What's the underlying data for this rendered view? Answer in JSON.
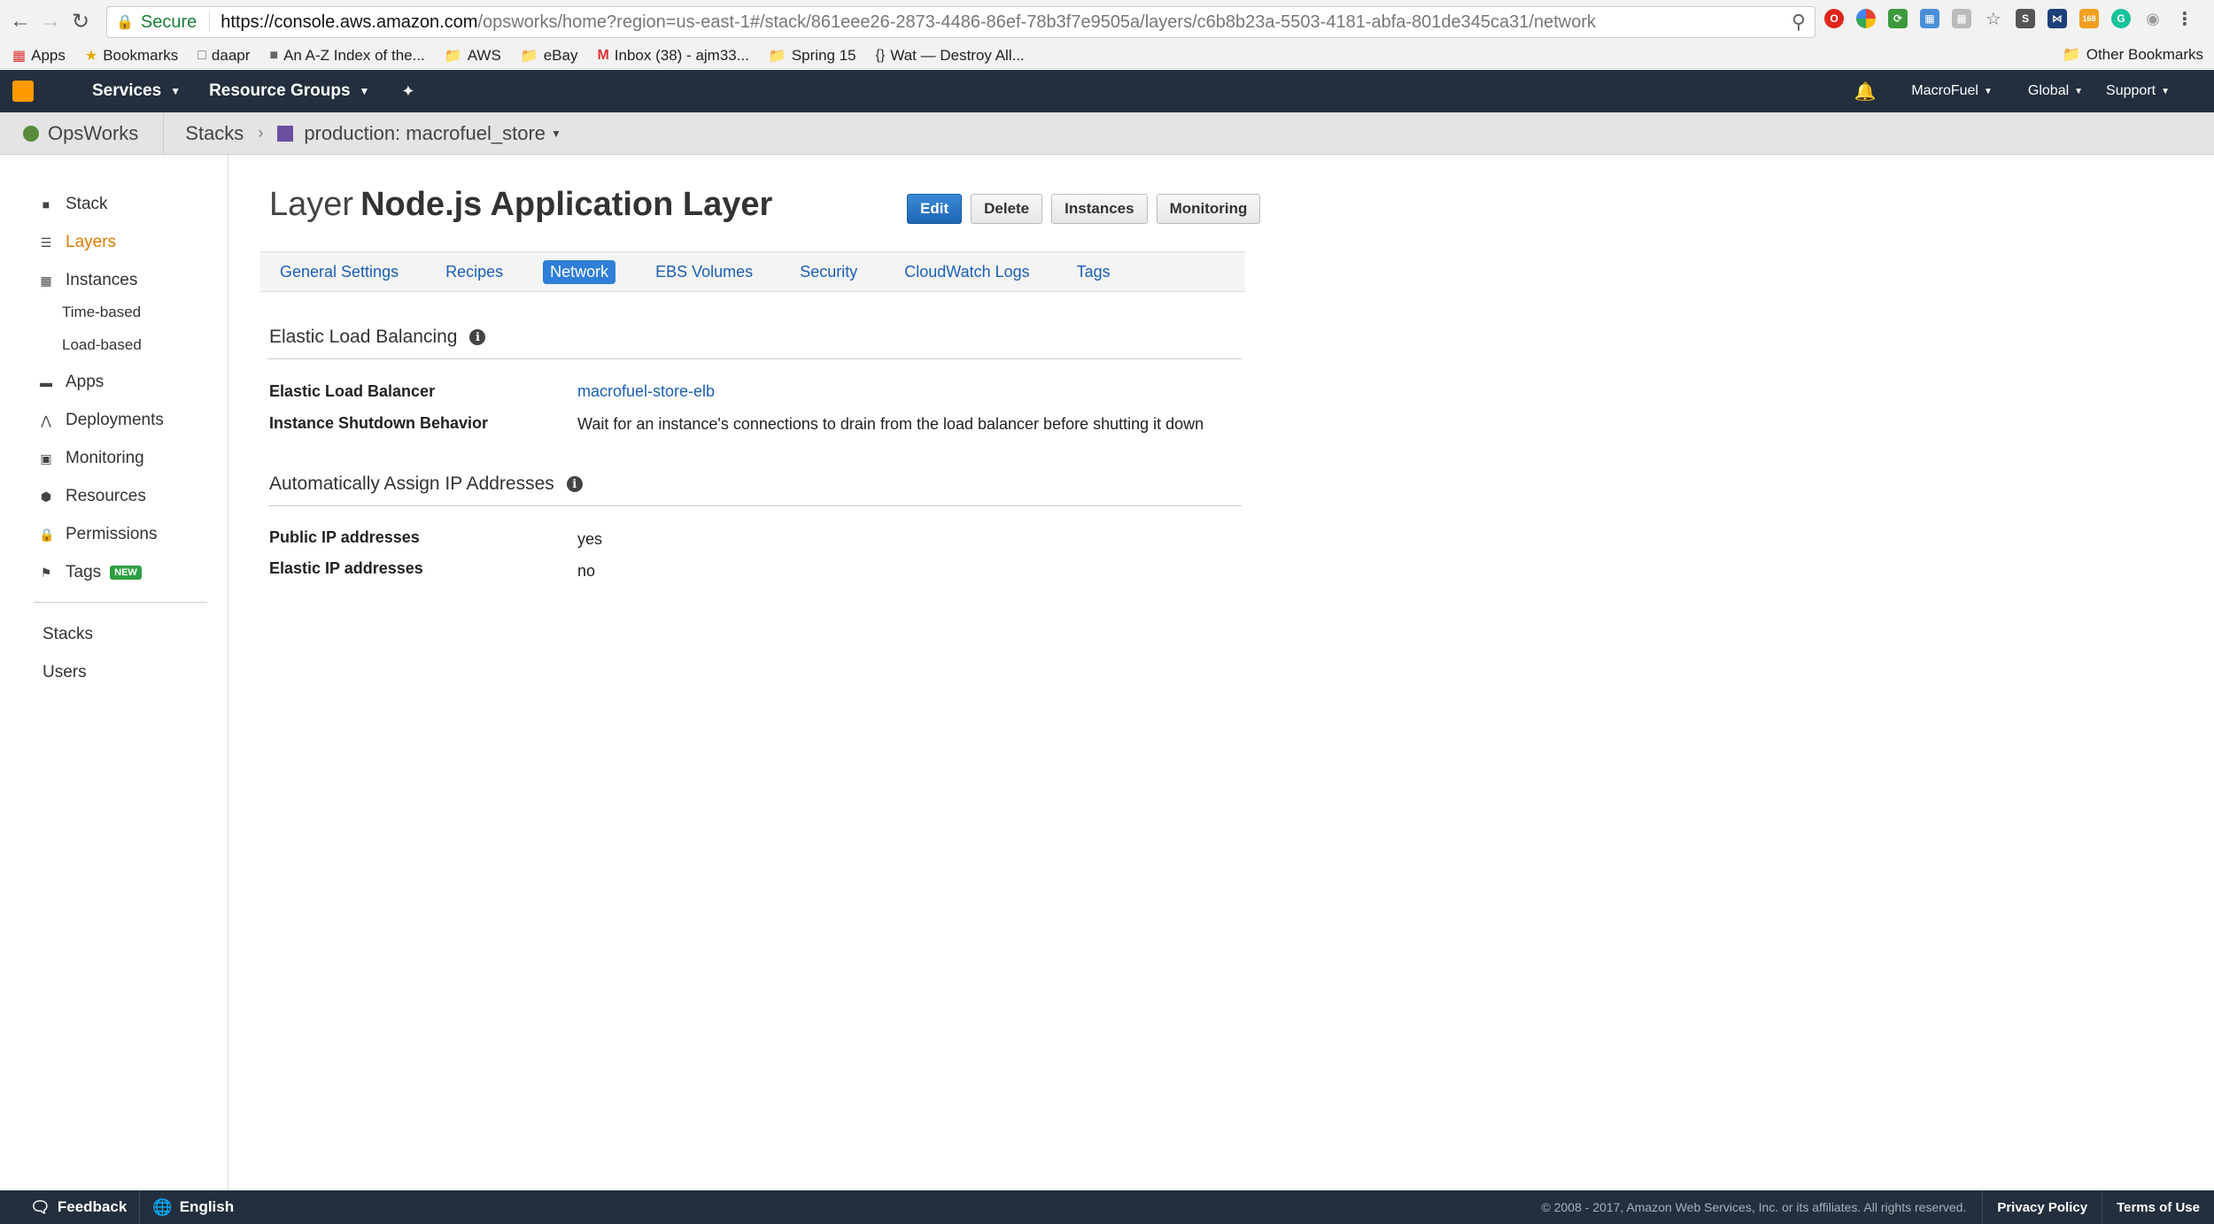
{
  "browser": {
    "secure_label": "Secure",
    "url_host": "https://console.aws.amazon.com",
    "url_path": "/opsworks/home?region=us-east-1#/stack/861eee26-2873-4486-86ef-78b3f7e9505a/layers/c6b8b23a-5503-4181-abfa-801de345ca31/network",
    "ext_badge": "168"
  },
  "bookmarks": {
    "items": [
      "Apps",
      "Bookmarks",
      "daapr",
      "An A-Z Index of the...",
      "AWS",
      "eBay",
      "Inbox (38) - ajm33...",
      "Spring 15",
      "Wat — Destroy All..."
    ],
    "other": "Other Bookmarks"
  },
  "awsbar": {
    "services": "Services",
    "resource_groups": "Resource Groups",
    "account": "MacroFuel",
    "region": "Global",
    "support": "Support"
  },
  "breadcrumb": {
    "service": "OpsWorks",
    "stacks": "Stacks",
    "stack": "production: macrofuel_store"
  },
  "sidebar": {
    "items": [
      "Stack",
      "Layers",
      "Instances",
      "Time-based",
      "Load-based",
      "Apps",
      "Deployments",
      "Monitoring",
      "Resources",
      "Permissions",
      "Tags"
    ],
    "badge_new": "NEW",
    "lower": [
      "Stacks",
      "Users"
    ],
    "active": "Layers"
  },
  "page": {
    "title_prefix": "Layer",
    "title_name": "Node.js Application Layer",
    "actions": [
      "Edit",
      "Delete",
      "Instances",
      "Monitoring"
    ],
    "tabs": [
      "General Settings",
      "Recipes",
      "Network",
      "EBS Volumes",
      "Security",
      "CloudWatch Logs",
      "Tags"
    ],
    "active_tab": "Network"
  },
  "elb": {
    "title": "Elastic Load Balancing",
    "rows": [
      {
        "label": "Elastic Load Balancer",
        "value": "macrofuel-store-elb"
      },
      {
        "label": "Instance Shutdown Behavior",
        "value": "Wait for an instance's connections to drain from the load balancer before shutting it down"
      }
    ]
  },
  "ip": {
    "title": "Automatically Assign IP Addresses",
    "rows": [
      {
        "label": "Public IP addresses",
        "value": "yes"
      },
      {
        "label": "Elastic IP addresses",
        "value": "no"
      }
    ]
  },
  "footer": {
    "feedback": "Feedback",
    "language": "English",
    "copyright": "© 2008 - 2017, Amazon Web Services, Inc. or its affiliates. All rights reserved.",
    "privacy": "Privacy Policy",
    "terms": "Terms of Use"
  },
  "colors": {
    "aws_dark": "#232f3e",
    "aws_orange": "#ff9900",
    "active_nav": "#e07b00",
    "link": "#1a5fb4",
    "primary_button": "#2f7ed8"
  }
}
